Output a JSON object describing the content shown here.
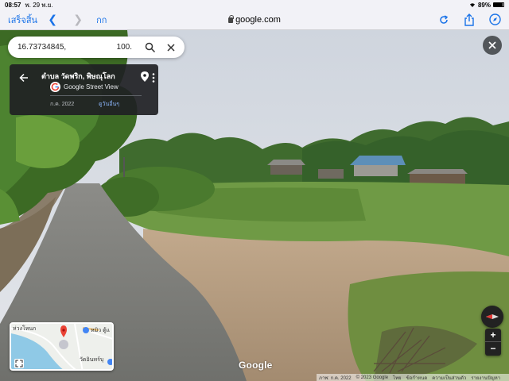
{
  "status_bar": {
    "time": "08:57",
    "date": "พ. 29 พ.ย.",
    "battery": "89%",
    "battery_level": 0.89
  },
  "browser": {
    "done_label": "เสร็จสิ้น",
    "aa_label": "กก",
    "url": "google.com",
    "icons": [
      "back-arrow-icon",
      "forward-arrow-icon",
      "lock-icon",
      "reload-icon",
      "share-icon",
      "compass-icon"
    ]
  },
  "search": {
    "coord_lat": "16.73734845,",
    "coord_lng": "100."
  },
  "info_card": {
    "title": "ตำบล วัดพริก, พิษณุโลก",
    "source": "Google Street View",
    "date": "ก.ค. 2022",
    "more_dates": "ดูวันอื่นๆ"
  },
  "minimap": {
    "label_top_left": "ห่วงโหนก",
    "label_top_right": "หมิว ตู้แ",
    "label_bottom_right": "วัดอินทร์บุ"
  },
  "watermark": "Google",
  "attribution": {
    "imagery": "ภาพ: ก.ค. 2022",
    "copyright": "© 2023 Google",
    "privacy": "ไทย",
    "terms": "ข้อกำหนด",
    "report": "ความเป็นส่วนตัว",
    "feedback": "รายงานปัญหา"
  },
  "colors": {
    "accent": "#1a73e8",
    "card_bg": "#202124",
    "sky": "#d6dbe3"
  }
}
